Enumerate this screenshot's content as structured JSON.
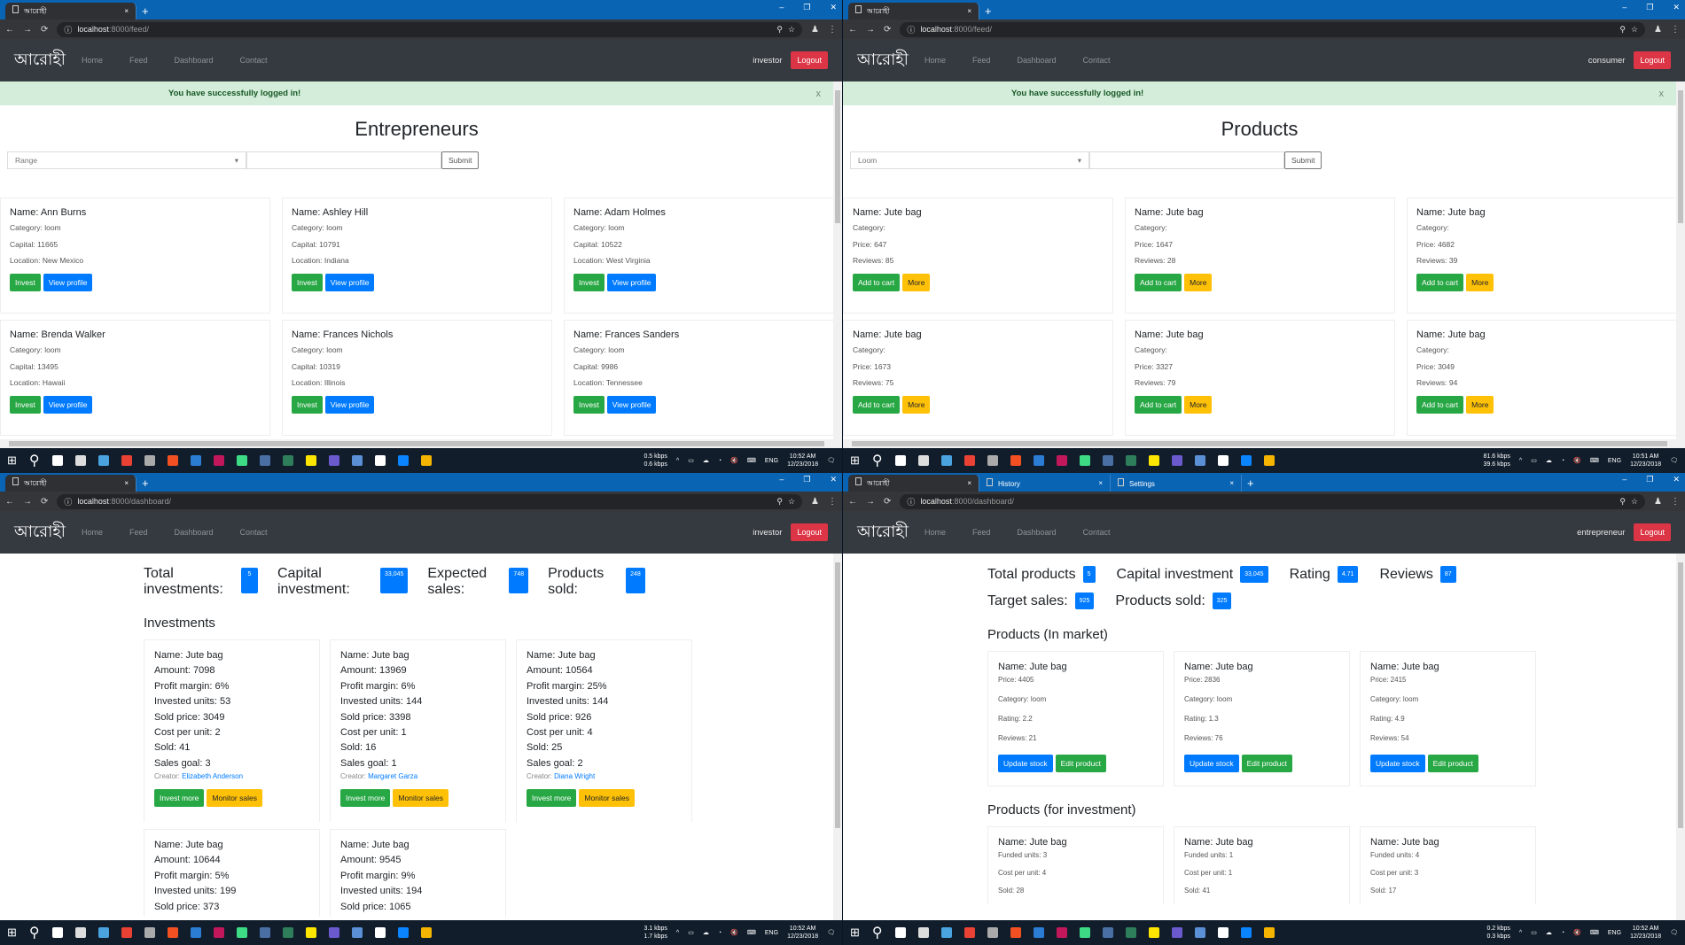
{
  "colors": {
    "success": "#28a745",
    "primary": "#007bff",
    "warning": "#ffc107",
    "danger": "#dc3545",
    "navbar": "#343a40",
    "alert_bg": "#d4edda"
  },
  "panes": [
    {
      "tabs": [
        {
          "title": "আরোহী",
          "active": true
        }
      ],
      "url_host": "localhost",
      "url_path": ":8000/feed/",
      "brand": "আরোহী",
      "nav": [
        "Home",
        "Feed",
        "Dashboard",
        "Contact"
      ],
      "user": "investor",
      "logout": "Logout",
      "alert": "You have successfully logged in!",
      "alert_close": "x",
      "page": {
        "type": "feed",
        "title": "Entrepreneurs",
        "select": "Range",
        "submit": "Submit",
        "cards": [
          {
            "name": "Name: Ann Burns",
            "fields": [
              "Category: loom",
              "Capital: 11665",
              "Location: New Mexico"
            ],
            "buttons": [
              {
                "label": "Invest",
                "color": "green"
              },
              {
                "label": "View profile",
                "color": "blue"
              }
            ]
          },
          {
            "name": "Name: Ashley Hill",
            "fields": [
              "Category: loom",
              "Capital: 10791",
              "Location: Indiana"
            ],
            "buttons": [
              {
                "label": "Invest",
                "color": "green"
              },
              {
                "label": "View profile",
                "color": "blue"
              }
            ]
          },
          {
            "name": "Name: Adam Holmes",
            "fields": [
              "Category: loom",
              "Capital: 10522",
              "Location: West Virginia"
            ],
            "buttons": [
              {
                "label": "Invest",
                "color": "green"
              },
              {
                "label": "View profile",
                "color": "blue"
              }
            ]
          },
          {
            "name": "Name: Brenda Walker",
            "fields": [
              "Category: loom",
              "Capital: 13495",
              "Location: Hawaii"
            ],
            "buttons": [
              {
                "label": "Invest",
                "color": "green"
              },
              {
                "label": "View profile",
                "color": "blue"
              }
            ]
          },
          {
            "name": "Name: Frances Nichols",
            "fields": [
              "Category: loom",
              "Capital: 10319",
              "Location: Illinois"
            ],
            "buttons": [
              {
                "label": "Invest",
                "color": "green"
              },
              {
                "label": "View profile",
                "color": "blue"
              }
            ]
          },
          {
            "name": "Name: Frances Sanders",
            "fields": [
              "Category: loom",
              "Capital: 9986",
              "Location: Tennessee"
            ],
            "buttons": [
              {
                "label": "Invest",
                "color": "green"
              },
              {
                "label": "View profile",
                "color": "blue"
              }
            ]
          }
        ]
      },
      "taskbar": {
        "down": "0.5 kbps",
        "up": "0.6 kbps",
        "lang": "ENG",
        "time": "10:52 AM",
        "date": "12/23/2018"
      }
    },
    {
      "tabs": [
        {
          "title": "আরোহী",
          "active": true
        }
      ],
      "url_host": "localhost",
      "url_path": ":8000/feed/",
      "brand": "আরোহী",
      "nav": [
        "Home",
        "Feed",
        "Dashboard",
        "Contact"
      ],
      "user": "consumer",
      "logout": "Logout",
      "alert": "You have successfully logged in!",
      "alert_close": "x",
      "page": {
        "type": "feed",
        "title": "Products",
        "select": "Loom",
        "submit": "Submit",
        "cards": [
          {
            "name": "Name: Jute bag",
            "fields": [
              "Category:",
              "Price: 647",
              "Reviews: 85"
            ],
            "buttons": [
              {
                "label": "Add to cart",
                "color": "green"
              },
              {
                "label": "More",
                "color": "yellow"
              }
            ]
          },
          {
            "name": "Name: Jute bag",
            "fields": [
              "Category:",
              "Price: 1647",
              "Reviews: 28"
            ],
            "buttons": [
              {
                "label": "Add to cart",
                "color": "green"
              },
              {
                "label": "More",
                "color": "yellow"
              }
            ]
          },
          {
            "name": "Name: Jute bag",
            "fields": [
              "Category:",
              "Price: 4682",
              "Reviews: 39"
            ],
            "buttons": [
              {
                "label": "Add to cart",
                "color": "green"
              },
              {
                "label": "More",
                "color": "yellow"
              }
            ]
          },
          {
            "name": "Name: Jute bag",
            "fields": [
              "Category:",
              "Price: 1673",
              "Reviews: 75"
            ],
            "buttons": [
              {
                "label": "Add to cart",
                "color": "green"
              },
              {
                "label": "More",
                "color": "yellow"
              }
            ]
          },
          {
            "name": "Name: Jute bag",
            "fields": [
              "Category:",
              "Price: 3327",
              "Reviews: 79"
            ],
            "buttons": [
              {
                "label": "Add to cart",
                "color": "green"
              },
              {
                "label": "More",
                "color": "yellow"
              }
            ]
          },
          {
            "name": "Name: Jute bag",
            "fields": [
              "Category:",
              "Price: 3049",
              "Reviews: 94"
            ],
            "buttons": [
              {
                "label": "Add to cart",
                "color": "green"
              },
              {
                "label": "More",
                "color": "yellow"
              }
            ]
          }
        ]
      },
      "taskbar": {
        "down": "81.6 kbps",
        "up": "39.6 kbps",
        "lang": "ENG",
        "time": "10:51 AM",
        "date": "12/23/2018"
      }
    },
    {
      "tabs": [
        {
          "title": "আরোহী",
          "active": true
        }
      ],
      "url_host": "localhost",
      "url_path": ":8000/dashboard/",
      "brand": "আরোহী",
      "nav": [
        "Home",
        "Feed",
        "Dashboard",
        "Contact"
      ],
      "user": "investor",
      "logout": "Logout",
      "page": {
        "type": "investor_dashboard",
        "stats": [
          {
            "label": "Total investments:",
            "value": "5"
          },
          {
            "label": "Capital investment:",
            "value": "33,045"
          },
          {
            "label": "Expected sales:",
            "value": "748"
          },
          {
            "label": "Products sold:",
            "value": "248"
          }
        ],
        "heading": "Investments",
        "cards": [
          {
            "lines": [
              "Name: Jute bag",
              "Amount: 7098",
              "Profit margin: 6%",
              "Invested units: 53",
              "Sold price: 3049",
              "Cost per unit: 2",
              "Sold: 41",
              "Sales goal: 3"
            ],
            "creator_label": "Creator: ",
            "creator": "Elizabeth Anderson",
            "buttons": [
              {
                "label": "Invest more",
                "color": "green"
              },
              {
                "label": "Monitor sales",
                "color": "yellow"
              }
            ]
          },
          {
            "lines": [
              "Name: Jute bag",
              "Amount: 13969",
              "Profit margin: 6%",
              "Invested units: 144",
              "Sold price: 3398",
              "Cost per unit: 1",
              "Sold: 16",
              "Sales goal: 1"
            ],
            "creator_label": "Creator: ",
            "creator": "Margaret Garza",
            "buttons": [
              {
                "label": "Invest more",
                "color": "green"
              },
              {
                "label": "Monitor sales",
                "color": "yellow"
              }
            ]
          },
          {
            "lines": [
              "Name: Jute bag",
              "Amount: 10564",
              "Profit margin: 25%",
              "Invested units: 144",
              "Sold price: 926",
              "Cost per unit: 4",
              "Sold: 25",
              "Sales goal: 2"
            ],
            "creator_label": "Creator: ",
            "creator": "Diana Wright",
            "buttons": [
              {
                "label": "Invest more",
                "color": "green"
              },
              {
                "label": "Monitor sales",
                "color": "yellow"
              }
            ]
          },
          {
            "lines": [
              "Name: Jute bag",
              "Amount: 10644",
              "Profit margin: 5%",
              "Invested units: 199",
              "Sold price: 373"
            ]
          },
          {
            "lines": [
              "Name: Jute bag",
              "Amount: 9545",
              "Profit margin: 9%",
              "Invested units: 194",
              "Sold price: 1065"
            ]
          }
        ]
      },
      "taskbar": {
        "down": "3.1 kbps",
        "up": "1.7 kbps",
        "lang": "ENG",
        "time": "10:52 AM",
        "date": "12/23/2018"
      }
    },
    {
      "tabs": [
        {
          "title": "আরোহী",
          "active": true
        },
        {
          "title": "History",
          "active": false
        },
        {
          "title": "Settings",
          "active": false
        }
      ],
      "url_host": "localhost",
      "url_path": ":8000/dashboard/",
      "brand": "আরোহী",
      "nav": [
        "Home",
        "Feed",
        "Dashboard",
        "Contact"
      ],
      "user": "entrepreneur",
      "logout": "Logout",
      "page": {
        "type": "entrepreneur_dashboard",
        "stats_row1": [
          {
            "label": "Total products",
            "value": "5"
          },
          {
            "label": "Capital investment",
            "value": "33,045"
          },
          {
            "label": "Rating",
            "value": "4.71"
          },
          {
            "label": "Reviews",
            "value": "87"
          }
        ],
        "stats_row2": [
          {
            "label": "Target sales:",
            "value": "925"
          },
          {
            "label": "Products sold:",
            "value": "325"
          }
        ],
        "market_heading": "Products (In market)",
        "market_cards": [
          {
            "name": "Name: Jute bag",
            "fields": [
              "Price: 4405",
              "Category: loom",
              "Rating: 2.2",
              "Reviews: 21"
            ],
            "buttons": [
              {
                "label": "Update stock",
                "color": "blue"
              },
              {
                "label": "Edit product",
                "color": "green"
              }
            ]
          },
          {
            "name": "Name: Jute bag",
            "fields": [
              "Price: 2836",
              "Category: loom",
              "Rating: 1.3",
              "Reviews: 76"
            ],
            "buttons": [
              {
                "label": "Update stock",
                "color": "blue"
              },
              {
                "label": "Edit product",
                "color": "green"
              }
            ]
          },
          {
            "name": "Name: Jute bag",
            "fields": [
              "Price: 2415",
              "Category: loom",
              "Rating: 4.9",
              "Reviews: 54"
            ],
            "buttons": [
              {
                "label": "Update stock",
                "color": "blue"
              },
              {
                "label": "Edit product",
                "color": "green"
              }
            ]
          }
        ],
        "invest_heading": "Products (for investment)",
        "invest_cards": [
          {
            "name": "Name: Jute bag",
            "fields": [
              "Funded units: 3",
              "Cost per unit: 4",
              "Sold: 28"
            ]
          },
          {
            "name": "Name: Jute bag",
            "fields": [
              "Funded units: 1",
              "Cost per unit: 1",
              "Sold: 41"
            ]
          },
          {
            "name": "Name: Jute bag",
            "fields": [
              "Funded units: 4",
              "Cost per unit: 3",
              "Sold: 17"
            ]
          }
        ]
      },
      "taskbar": {
        "down": "0.2 kbps",
        "up": "0.3 kbps",
        "lang": "ENG",
        "time": "10:52 AM",
        "date": "12/23/2018"
      }
    }
  ]
}
